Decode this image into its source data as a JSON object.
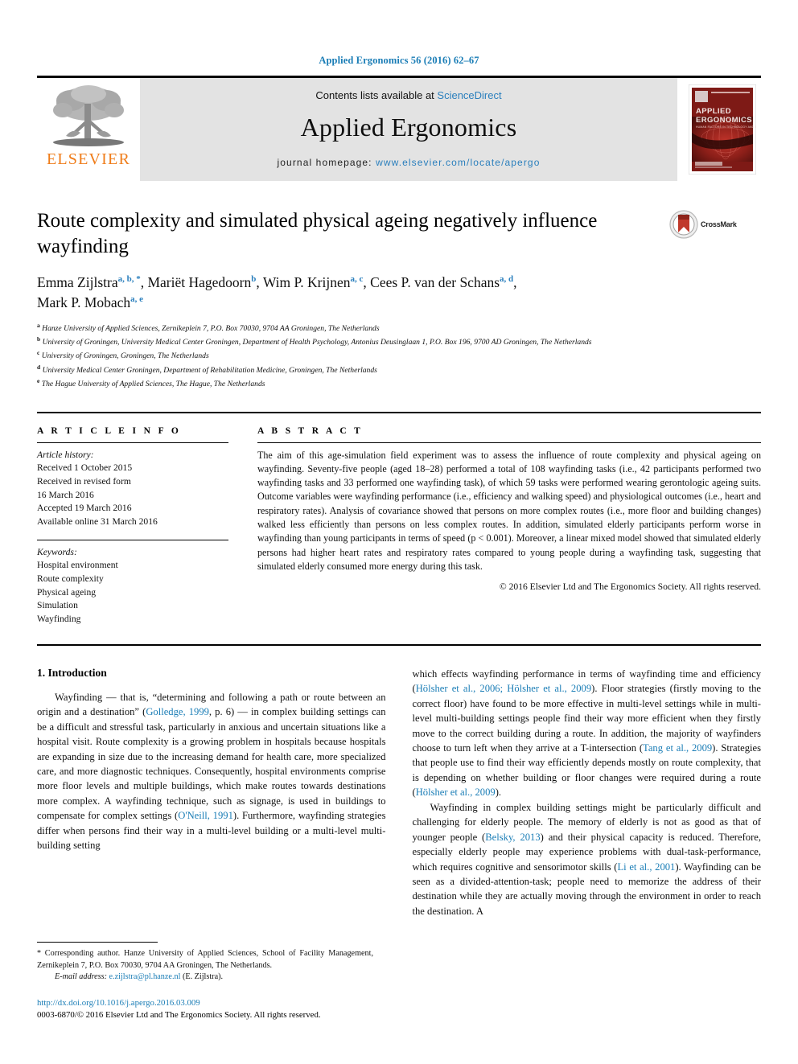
{
  "running_head": "Applied Ergonomics 56 (2016) 62–67",
  "masthead": {
    "contents_prefix": "Contents lists available at ",
    "sciencedirect": "ScienceDirect",
    "journal_title": "Applied Ergonomics",
    "homepage_label": "journal homepage: ",
    "homepage_url": "www.elsevier.com/locate/apergo",
    "publisher_logo_text": "ELSEVIER",
    "cover_title_line1": "APPLIED",
    "cover_title_line2": "ERGONOMICS",
    "cover_subtitle": "HUMAN FACTORS IN TECHNOLOGY AND SOCIETY",
    "accent_blue": "#2a7fbd",
    "elsevier_orange": "#ef7c19",
    "cover_red": "#8f1f1a"
  },
  "article": {
    "title": "Route complexity and simulated physical ageing negatively influence wayfinding",
    "crossmark_label": "CrossMark",
    "authors_line1": "Emma Zijlstra",
    "authors": [
      {
        "name": "Emma Zijlstra",
        "marks": "a, b, *"
      },
      {
        "name": "Mariët Hagedoorn",
        "marks": "b"
      },
      {
        "name": "Wim P. Krijnen",
        "marks": "a, c"
      },
      {
        "name": "Cees P. van der Schans",
        "marks": "a, d"
      },
      {
        "name": "Mark P. Mobach",
        "marks": "a, e"
      }
    ],
    "affiliations": [
      {
        "mark": "a",
        "text": "Hanze University of Applied Sciences, Zernikeplein 7, P.O. Box 70030, 9704 AA Groningen, The Netherlands"
      },
      {
        "mark": "b",
        "text": "University of Groningen, University Medical Center Groningen, Department of Health Psychology, Antonius Deusinglaan 1, P.O. Box 196, 9700 AD Groningen, The Netherlands"
      },
      {
        "mark": "c",
        "text": "University of Groningen, Groningen, The Netherlands"
      },
      {
        "mark": "d",
        "text": "University Medical Center Groningen, Department of Rehabilitation Medicine, Groningen, The Netherlands"
      },
      {
        "mark": "e",
        "text": "The Hague University of Applied Sciences, The Hague, The Netherlands"
      }
    ]
  },
  "article_info": {
    "heading": "A R T I C L E  I N F O",
    "history_label": "Article history:",
    "history": [
      "Received 1 October 2015",
      "Received in revised form",
      "16 March 2016",
      "Accepted 19 March 2016",
      "Available online 31 March 2016"
    ],
    "keywords_label": "Keywords:",
    "keywords": [
      "Hospital environment",
      "Route complexity",
      "Physical ageing",
      "Simulation",
      "Wayfinding"
    ]
  },
  "abstract": {
    "heading": "A B S T R A C T",
    "text": "The aim of this age-simulation field experiment was to assess the influence of route complexity and physical ageing on wayfinding. Seventy-five people (aged 18–28) performed a total of 108 wayfinding tasks (i.e., 42 participants performed two wayfinding tasks and 33 performed one wayfinding task), of which 59 tasks were performed wearing gerontologic ageing suits. Outcome variables were wayfinding performance (i.e., efficiency and walking speed) and physiological outcomes (i.e., heart and respiratory rates). Analysis of covariance showed that persons on more complex routes (i.e., more floor and building changes) walked less efficiently than persons on less complex routes. In addition, simulated elderly participants perform worse in wayfinding than young participants in terms of speed (p < 0.001). Moreover, a linear mixed model showed that simulated elderly persons had higher heart rates and respiratory rates compared to young people during a wayfinding task, suggesting that simulated elderly consumed more energy during this task.",
    "copyright": "© 2016 Elsevier Ltd and The Ergonomics Society. All rights reserved."
  },
  "body": {
    "section_number_title": "1. Introduction",
    "left_paragraph_1_a": "Wayfinding — that is, “determining and following a path or route between an origin and a destination” (",
    "left_ref_1": "Golledge, 1999",
    "left_paragraph_1_b": ", p. 6) — in complex building settings can be a difficult and stressful task, particularly in anxious and uncertain situations like a hospital visit. Route complexity is a growing problem in hospitals because hospitals are expanding in size due to the increasing demand for health care, more specialized care, and more diagnostic techniques. Consequently, hospital environments comprise more floor levels and multiple buildings, which make routes towards destinations more complex. A wayfinding technique, such as signage, is used in buildings to compensate for complex settings (",
    "left_ref_2": "O'Neill, 1991",
    "left_paragraph_1_c": "). Furthermore, wayfinding strategies differ when persons find their way in a multi-level building or a multi-level multi-building setting",
    "right_paragraph_1_a": "which effects wayfinding performance in terms of wayfinding time and efficiency (",
    "right_ref_1": "Hölsher et al., 2006; Hölsher et al., 2009",
    "right_paragraph_1_b": "). Floor strategies (firstly moving to the correct floor) have found to be more effective in multi-level settings while in multi-level multi-building settings people find their way more efficient when they firstly move to the correct building during a route. In addition, the majority of wayfinders choose to turn left when they arrive at a T-intersection (",
    "right_ref_2": "Tang et al., 2009",
    "right_paragraph_1_c": "). Strategies that people use to find their way efficiently depends mostly on route complexity, that is depending on whether building or floor changes were required during a route (",
    "right_ref_3": "Hölsher et al., 2009",
    "right_paragraph_1_d": ").",
    "right_paragraph_2_a": "Wayfinding in complex building settings might be particularly difficult and challenging for elderly people. The memory of elderly is not as good as that of younger people (",
    "right_ref_4": "Belsky, 2013",
    "right_paragraph_2_b": ") and their physical capacity is reduced. Therefore, especially elderly people may experience problems with dual-task-performance, which requires cognitive and sensorimotor skills (",
    "right_ref_5": "Li et al., 2001",
    "right_paragraph_2_c": "). Wayfinding can be seen as a divided-attention-task; people need to memorize the address of their destination while they are actually moving through the environment in order to reach the destination. A"
  },
  "footer": {
    "corresponding_star": "*",
    "corresponding_text": " Corresponding author. Hanze University of Applied Sciences, School of Facility Management, Zernikeplein 7, P.O. Box 70030, 9704 AA Groningen, The Netherlands.",
    "email_label": "E-mail address:",
    "email": "e.zijlstra@pl.hanze.nl",
    "email_owner": " (E. Zijlstra).",
    "doi": "http://dx.doi.org/10.1016/j.apergo.2016.03.009",
    "issn_line": "0003-6870/© 2016 Elsevier Ltd and The Ergonomics Society. All rights reserved."
  }
}
